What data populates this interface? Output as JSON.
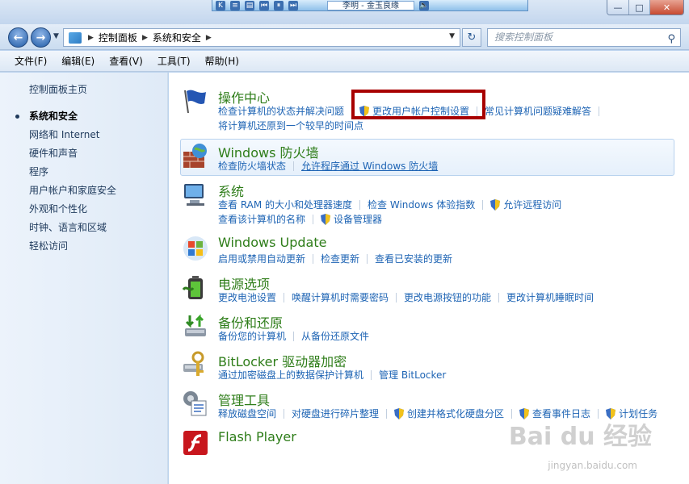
{
  "media_player": {
    "song": "李明 - 金玉良缘",
    "k": "K"
  },
  "window": {
    "min": "—",
    "max": "□",
    "close": "✕"
  },
  "address": {
    "path": [
      "控制面板",
      "系统和安全"
    ],
    "search_placeholder": "搜索控制面板"
  },
  "menu": [
    "文件(F)",
    "编辑(E)",
    "查看(V)",
    "工具(T)",
    "帮助(H)"
  ],
  "sidebar": {
    "home": "控制面板主页",
    "items": [
      "系统和安全",
      "网络和 Internet",
      "硬件和声音",
      "程序",
      "用户帐户和家庭安全",
      "外观和个性化",
      "时钟、语言和区域",
      "轻松访问"
    ]
  },
  "categories": [
    {
      "title": "操作中心",
      "icon": "flag-icon",
      "links1": [
        "检查计算机的状态并解决问题",
        "更改用户帐户控制设置",
        "常见计算机问题疑难解答"
      ],
      "links2": [
        "将计算机还原到一个较早的时间点"
      ]
    },
    {
      "title": "Windows 防火墙",
      "icon": "firewall-icon",
      "links1": [
        "检查防火墙状态",
        "允许程序通过 Windows 防火墙"
      ]
    },
    {
      "title": "系统",
      "icon": "computer-icon",
      "links1": [
        "查看 RAM 的大小和处理器速度",
        "检查 Windows 体验指数",
        "允许远程访问"
      ],
      "links2": [
        "查看该计算机的名称",
        "设备管理器"
      ]
    },
    {
      "title": "Windows Update",
      "icon": "update-icon",
      "links1": [
        "启用或禁用自动更新",
        "检查更新",
        "查看已安装的更新"
      ]
    },
    {
      "title": "电源选项",
      "icon": "battery-icon",
      "links1": [
        "更改电池设置",
        "唤醒计算机时需要密码",
        "更改电源按钮的功能",
        "更改计算机睡眠时间"
      ]
    },
    {
      "title": "备份和还原",
      "icon": "backup-icon",
      "links1": [
        "备份您的计算机",
        "从备份还原文件"
      ]
    },
    {
      "title": "BitLocker 驱动器加密",
      "icon": "bitlocker-icon",
      "links1": [
        "通过加密磁盘上的数据保护计算机",
        "管理 BitLocker"
      ]
    },
    {
      "title": "管理工具",
      "icon": "admin-tools-icon",
      "links1": [
        "释放磁盘空间",
        "对硬盘进行碎片整理",
        "创建并格式化硬盘分区",
        "查看事件日志",
        "计划任务"
      ]
    },
    {
      "title": "Flash Player",
      "icon": "flash-icon"
    }
  ],
  "watermark": {
    "main": "Bai du 经验",
    "sub": "jingyan.baidu.com"
  }
}
